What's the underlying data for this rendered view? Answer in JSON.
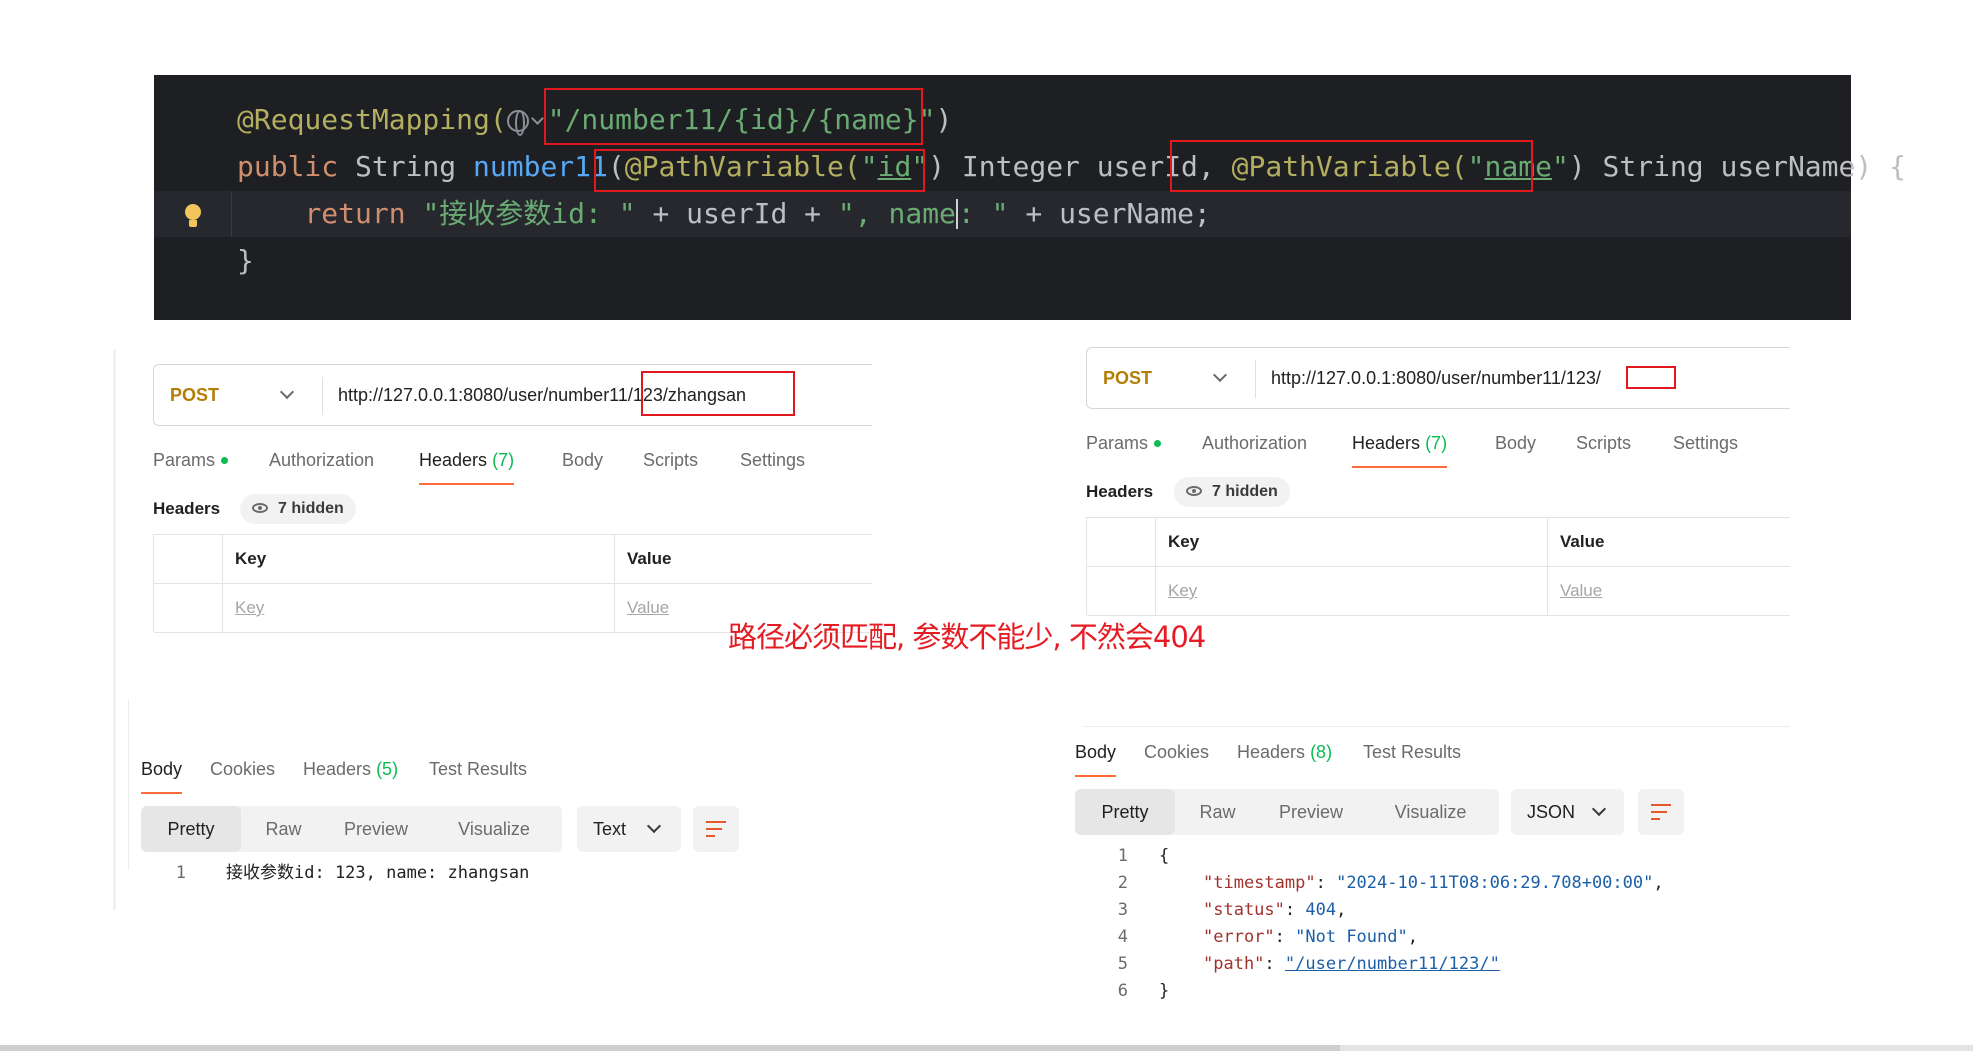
{
  "editor": {
    "line1": {
      "annotation": "@RequestMapping(",
      "path": "\"/number11/{id}/{name}\"",
      "close": ")"
    },
    "line2": {
      "kw_public": "public",
      "type_string": " String ",
      "method": "number11",
      "paren_open": "(",
      "pv1": "@PathVariable(",
      "pv1_str_open": "\"",
      "pv1_name": "id",
      "pv1_str_close": "\"",
      "pv1_close": ")",
      "mid": " Integer userId, ",
      "pv2": "@PathVariable(",
      "pv2_str_open": "\"",
      "pv2_name": "name",
      "pv2_str_close": "\"",
      "pv2_close": ")",
      "tail": " String userName) {"
    },
    "line3": {
      "kw_return": "return",
      "str1": "\"接收参数id: \"",
      "mid1": " + userId + ",
      "str2a": "\", name",
      "str2b": ": \"",
      "tail": " + userName;"
    },
    "line4": {
      "brace": "}"
    }
  },
  "left": {
    "method": "POST",
    "url": "http://127.0.0.1:8080/user/number11/123/zhangsan",
    "tabs": [
      {
        "label": "Params"
      },
      {
        "label": "Authorization"
      },
      {
        "label": "Headers",
        "count": "(7)"
      },
      {
        "label": "Body"
      },
      {
        "label": "Scripts"
      },
      {
        "label": "Settings"
      }
    ],
    "headers_title": "Headers",
    "hidden_chip": "7 hidden",
    "table": {
      "key_header": "Key",
      "value_header": "Value",
      "key_placeholder": "Key",
      "value_placeholder": "Value"
    },
    "resp_tabs": [
      {
        "label": "Body"
      },
      {
        "label": "Cookies"
      },
      {
        "label": "Headers",
        "count": "(5)"
      },
      {
        "label": "Test Results"
      }
    ],
    "view_modes": [
      "Pretty",
      "Raw",
      "Preview",
      "Visualize"
    ],
    "format": "Text",
    "response_lines": [
      {
        "n": "1",
        "text": "接收参数id: 123, name: zhangsan"
      }
    ]
  },
  "right": {
    "method": "POST",
    "url": "http://127.0.0.1:8080/user/number11/123/",
    "tabs": [
      {
        "label": "Params"
      },
      {
        "label": "Authorization"
      },
      {
        "label": "Headers",
        "count": "(7)"
      },
      {
        "label": "Body"
      },
      {
        "label": "Scripts"
      },
      {
        "label": "Settings"
      }
    ],
    "headers_title": "Headers",
    "hidden_chip": "7 hidden",
    "table": {
      "key_header": "Key",
      "value_header": "Value",
      "key_placeholder": "Key",
      "value_placeholder": "Value"
    },
    "resp_tabs": [
      {
        "label": "Body"
      },
      {
        "label": "Cookies"
      },
      {
        "label": "Headers",
        "count": "(8)"
      },
      {
        "label": "Test Results"
      }
    ],
    "view_modes": [
      "Pretty",
      "Raw",
      "Preview",
      "Visualize"
    ],
    "format": "JSON",
    "json": {
      "open": "{",
      "close": "}",
      "timestamp_key": "\"timestamp\"",
      "timestamp_val": "\"2024-10-11T08:06:29.708+00:00\"",
      "status_key": "\"status\"",
      "status_val": "404",
      "error_key": "\"error\"",
      "error_val": "\"Not Found\"",
      "path_key": "\"path\"",
      "path_val": "\"/user/number11/123/\""
    },
    "line_numbers": [
      "1",
      "2",
      "3",
      "4",
      "5",
      "6"
    ]
  },
  "note": "路径必须匹配, 参数不能少, 不然会404",
  "colors": {
    "accent": "#ff6c37",
    "highlight": "#e0191f",
    "method": "#b37e06"
  }
}
